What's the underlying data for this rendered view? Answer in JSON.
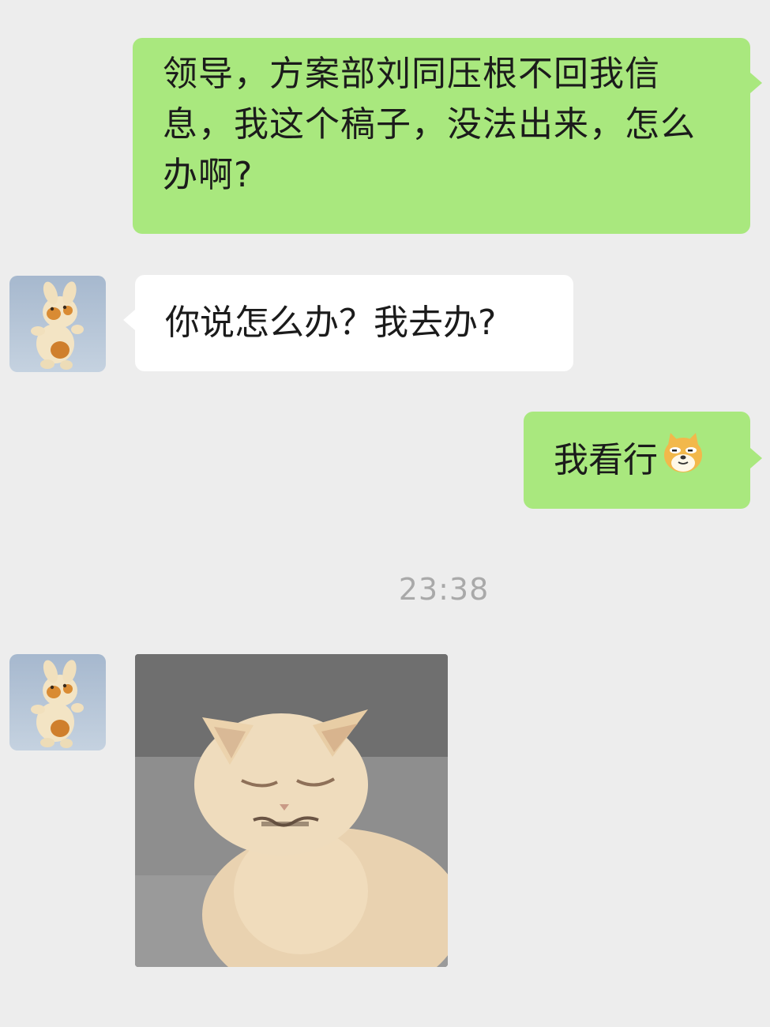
{
  "messages": [
    {
      "id": "msg1",
      "direction": "outgoing",
      "text": "领导，方案部刘同压根不回我信息，我这个稿子，没法出来，怎么办啊?"
    },
    {
      "id": "msg2",
      "direction": "incoming",
      "text": "你说怎么办？我去办?"
    },
    {
      "id": "msg3",
      "direction": "outgoing",
      "text": "我看行",
      "emoji": "doge-emoji"
    }
  ],
  "timestamp": "23:38",
  "photo_message": {
    "direction": "incoming",
    "content": "cat-photo"
  },
  "avatar": {
    "content": "plush-toy-avatar"
  },
  "colors": {
    "background": "#ededed",
    "outgoing_bubble": "#a9e87e",
    "incoming_bubble": "#ffffff",
    "timestamp_text": "#a9a9a9"
  }
}
